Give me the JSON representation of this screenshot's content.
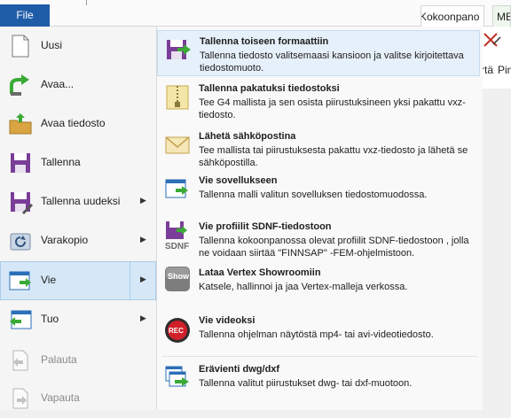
{
  "topbar": {
    "file_tab": "File",
    "tabs": [
      {
        "label": "Kokoonpano"
      },
      {
        "label": "ME"
      }
    ],
    "ribbon_peek": {
      "label_1": "rtä",
      "label_2": "Pin"
    }
  },
  "left_menu": {
    "items": [
      {
        "label": "Uusi",
        "icon": "new-document-icon",
        "enabled": true,
        "has_submenu": false
      },
      {
        "label": "Avaa...",
        "icon": "open-arrow-icon",
        "enabled": true,
        "has_submenu": false
      },
      {
        "label": "Avaa tiedosto",
        "icon": "open-folder-icon",
        "enabled": true,
        "has_submenu": false
      },
      {
        "label": "Tallenna",
        "icon": "save-icon",
        "enabled": true,
        "has_submenu": false
      },
      {
        "label": "Tallenna uudeksi",
        "icon": "save-as-icon",
        "enabled": true,
        "has_submenu": true
      },
      {
        "label": "Varakopio",
        "icon": "backup-icon",
        "enabled": true,
        "has_submenu": true
      },
      {
        "label": "Vie",
        "icon": "export-icon",
        "enabled": true,
        "has_submenu": true,
        "active": true
      },
      {
        "label": "Tuo",
        "icon": "import-icon",
        "enabled": true,
        "has_submenu": true
      },
      {
        "label": "Palauta",
        "icon": "restore-icon",
        "enabled": false,
        "has_submenu": false
      },
      {
        "label": "Vapauta",
        "icon": "release-icon",
        "enabled": false,
        "has_submenu": false
      }
    ]
  },
  "submenu": {
    "items": [
      {
        "title": "Tallenna toiseen formaattiin",
        "desc": "Tallenna tiedosto valitsemaasi kansioon ja valitse kirjoitettava tiedostomuoto.",
        "icon": "save-format-icon"
      },
      {
        "title": "Tallenna pakatuksi tiedostoksi",
        "desc": "Tee G4 mallista ja sen osista piirustuksineen yksi pakattu vxz-tiedosto.",
        "icon": "zip-icon"
      },
      {
        "title": "Lähetä sähköpostina",
        "desc": "Tee mallista tai piirustuksesta pakattu vxz-tiedosto ja lähetä se sähköpostilla.",
        "icon": "envelope-icon"
      },
      {
        "title": "Vie sovellukseen",
        "desc": "Tallenna malli valitun sovelluksen tiedostomuodossa.",
        "icon": "export-app-icon"
      },
      {
        "title": "Vie profiilit SDNF-tiedostoon",
        "desc": "Tallenna kokoonpanossa olevat profiilit SDNF-tiedostoon , jolla ne voidaan siirtää \"FINNSAP\" -FEM-ohjelmistoon.",
        "icon": "sdnf-icon",
        "icon_text": "SDNF"
      },
      {
        "title": "Lataa Vertex Showroomiin",
        "desc": "Katsele, hallinnoi ja jaa Vertex-malleja verkossa.",
        "icon": "showroom-icon",
        "icon_text": "Show"
      },
      {
        "title": "Vie videoksi",
        "desc": "Tallenna ohjelman näytöstä mp4- tai avi-videotiedosto.",
        "icon": "record-icon",
        "icon_text": "REC"
      },
      {
        "title": "Erävienti dwg/dxf",
        "desc": "Tallenna valitut piirustukset dwg- tai dxf-muotoon.",
        "icon": "batch-export-icon"
      }
    ]
  },
  "colors": {
    "file_tab": "#1f5ca8",
    "active_item": "#d6e8f8",
    "active_border": "#a8cbe8",
    "accent_green": "#3aaa35",
    "save_purple": "#7a3e98"
  }
}
